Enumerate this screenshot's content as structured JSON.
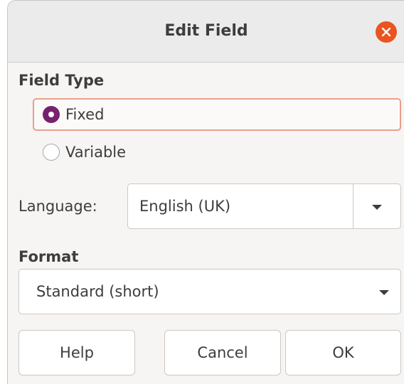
{
  "dialog": {
    "title": "Edit Field"
  },
  "field_type": {
    "heading": "Field Type",
    "options": [
      {
        "label": "Fixed",
        "checked": true
      },
      {
        "label": "Variable",
        "checked": false
      }
    ]
  },
  "language": {
    "label": "Language:",
    "value": "English (UK)"
  },
  "format": {
    "heading": "Format",
    "value": "Standard (short)"
  },
  "buttons": {
    "help": "Help",
    "cancel": "Cancel",
    "ok": "OK"
  },
  "colors": {
    "accent_close": "#e95420",
    "radio_checked": "#77216f",
    "focus_ring": "#e9a08a"
  }
}
